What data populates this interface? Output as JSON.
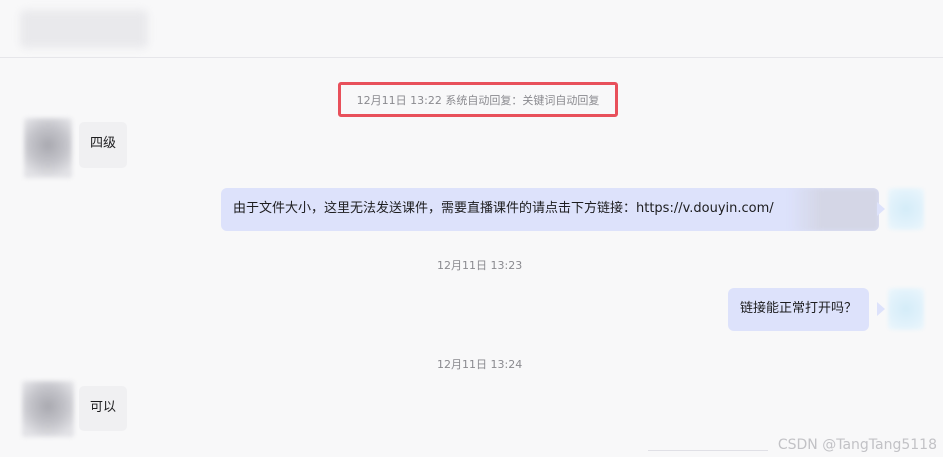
{
  "header": {
    "contact_name": ""
  },
  "messages": [
    {
      "timestamp": "12月11日 13:22 系统自动回复：关键词自动回复",
      "text": "四级",
      "side": "left"
    },
    {
      "text": "由于文件大小，这里无法发送课件，需要直播课件的请点击下方链接：https://v.douyin.com/",
      "side": "right"
    },
    {
      "timestamp": "12月11日 13:23",
      "text": "链接能正常打开吗？",
      "side": "right"
    },
    {
      "timestamp": "12月11日 13:24",
      "text": "可以",
      "side": "left"
    }
  ],
  "watermark": "CSDN @TangTang5118",
  "colors": {
    "highlight_border": "#e8505b",
    "outgoing_bubble": "#dde2fb",
    "incoming_bubble": "#f0f0f2"
  }
}
